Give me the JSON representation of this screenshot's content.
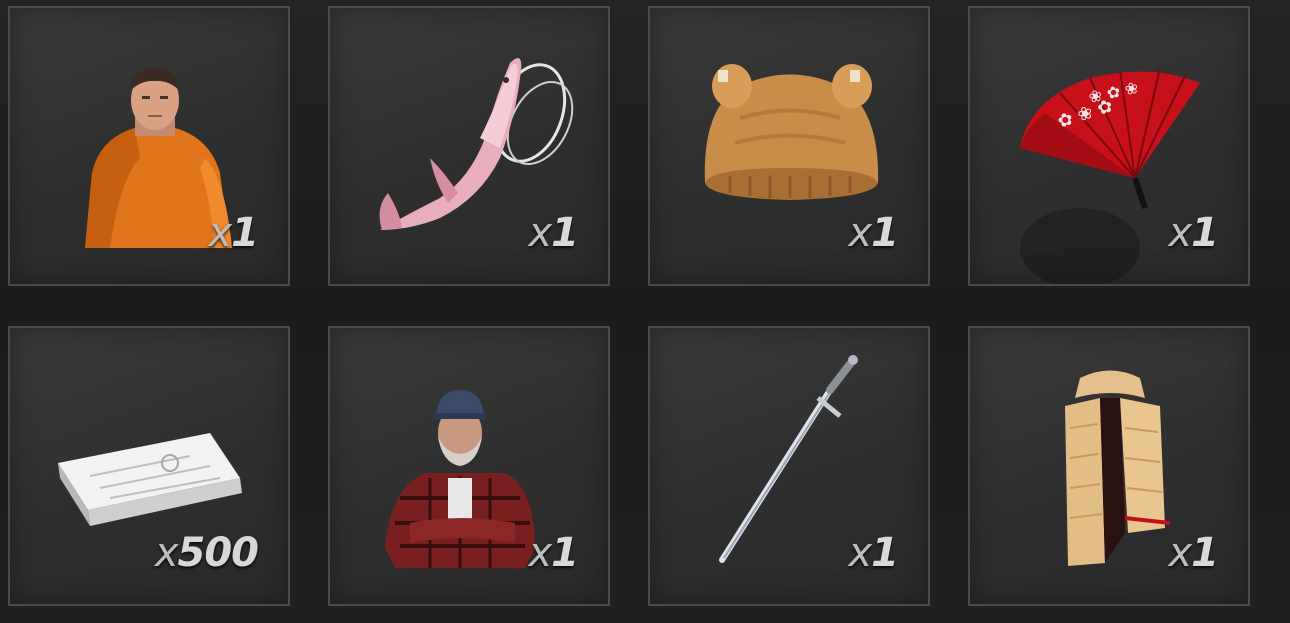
{
  "inventory": {
    "items": [
      {
        "name": "orange-hoodie-outfit",
        "prefix": "x",
        "quantity": "1"
      },
      {
        "name": "pink-shark-ornament",
        "prefix": "x",
        "quantity": "1"
      },
      {
        "name": "knit-animal-hat",
        "prefix": "x",
        "quantity": "1"
      },
      {
        "name": "red-folding-fan",
        "prefix": "x",
        "quantity": "1"
      },
      {
        "name": "cash-bundle",
        "prefix": "x",
        "quantity": "500"
      },
      {
        "name": "plaid-shirt-outfit",
        "prefix": "x",
        "quantity": "1"
      },
      {
        "name": "steel-sword",
        "prefix": "x",
        "quantity": "1"
      },
      {
        "name": "knit-scarf",
        "prefix": "x",
        "quantity": "1"
      }
    ]
  },
  "colors": {
    "slot_bg": "#2e2e2e",
    "slot_border": "#4a4a4a",
    "quantity_text": "#d8d8d8"
  }
}
